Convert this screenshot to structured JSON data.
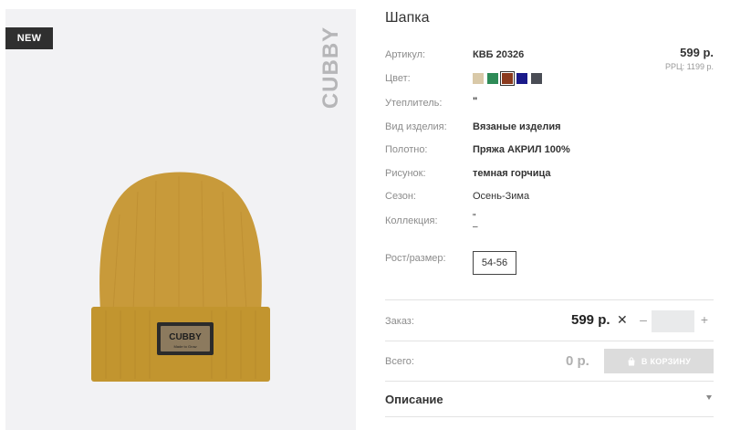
{
  "product": {
    "badge": "NEW",
    "brand": "CUBBY",
    "hat_label_main": "CUBBY",
    "hat_label_sub": "Made to Grow",
    "title": "Шапка",
    "price": "599 р.",
    "rrp": "РРЦ: 1199 р."
  },
  "attributes": {
    "article_label": "Артикул:",
    "article_value": "КВБ 20326",
    "color_label": "Цвет:",
    "insulation_label": "Утеплитель:",
    "insulation_value": "\"",
    "type_label": "Вид изделия:",
    "type_value": "Вязаные изделия",
    "fabric_label": "Полотно:",
    "fabric_value": "Пряжа АКРИЛ 100%",
    "pattern_label": "Рисунок:",
    "pattern_value": "темная горчица",
    "season_label": "Сезон:",
    "season_value": "Осень-Зима",
    "collection_label": "Коллекция:",
    "collection_value_line1": "\"",
    "collection_value_line2": "–",
    "size_label": "Рост/размер:",
    "size_value": "54-56"
  },
  "colors": {
    "swatches": [
      "#d9c9a8",
      "#2e8b57",
      "#8b3a1e",
      "#1a1a8a",
      "#4a4d55"
    ],
    "selected_index": 2,
    "hat_mustard": "#c89a3a"
  },
  "order": {
    "label": "Заказ:",
    "price": "599 р.",
    "remove_glyph": "✕",
    "minus_glyph": "–",
    "plus_glyph": "+",
    "quantity": ""
  },
  "total": {
    "label": "Всего:",
    "value": "0 р.",
    "cart_button": "В КОРЗИНУ"
  },
  "description": {
    "label": "Описание"
  }
}
